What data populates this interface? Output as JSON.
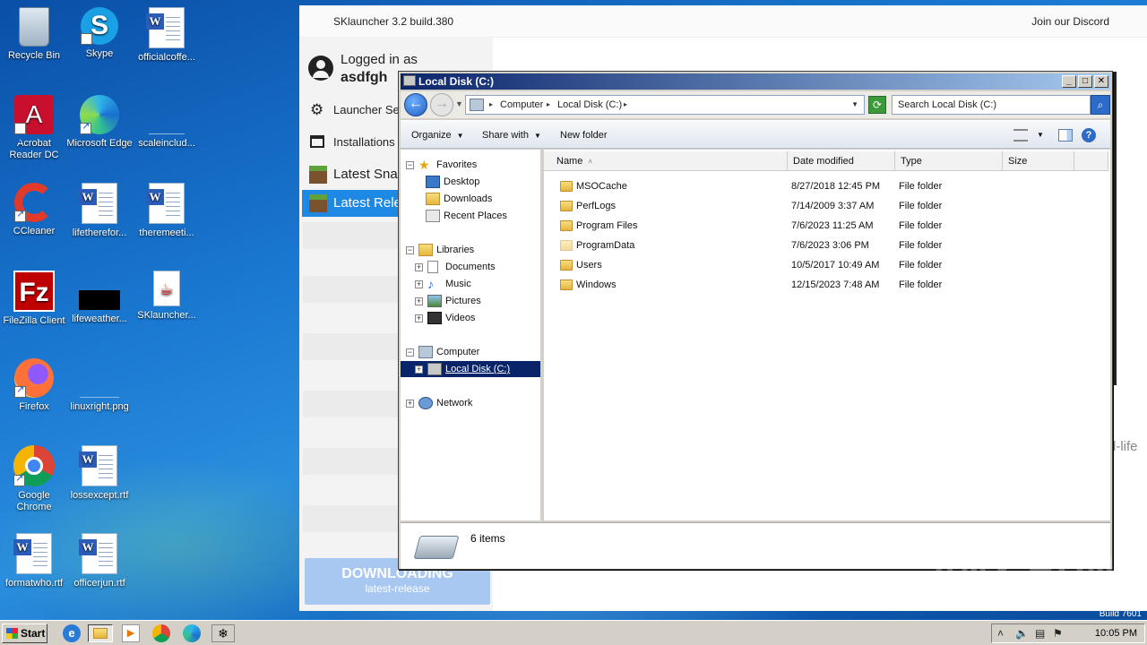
{
  "desktop_icons": [
    {
      "label": "Recycle Bin",
      "icon": "recycle-bin-icon"
    },
    {
      "label": "Skype",
      "icon": "skype-icon"
    },
    {
      "label": "officialcoffe...",
      "icon": "word-doc-icon"
    },
    {
      "label": "Acrobat Reader DC",
      "icon": "acrobat-icon"
    },
    {
      "label": "Microsoft Edge",
      "icon": "edge-icon"
    },
    {
      "label": "scaleinclud...",
      "icon": "image-file-icon"
    },
    {
      "label": "CCleaner",
      "icon": "ccleaner-icon"
    },
    {
      "label": "lifetherefor...",
      "icon": "word-doc-icon"
    },
    {
      "label": "theremeeti...",
      "icon": "word-doc-icon"
    },
    {
      "label": "FileZilla Client",
      "icon": "filezilla-icon"
    },
    {
      "label": "lifeweather...",
      "icon": "image-file-icon"
    },
    {
      "label": "SKlauncher...",
      "icon": "java-file-icon"
    },
    {
      "label": "Firefox",
      "icon": "firefox-icon"
    },
    {
      "label": "linuxright.png",
      "icon": "image-file-icon"
    },
    {
      "label": "Google Chrome",
      "icon": "chrome-icon"
    },
    {
      "label": "lossexcept.rtf",
      "icon": "word-doc-icon"
    },
    {
      "label": "formatwho.rtf",
      "icon": "word-doc-icon"
    },
    {
      "label": "officerjun.rtf",
      "icon": "word-doc-icon"
    }
  ],
  "sklauncher": {
    "title": "SKlauncher 3.2 build.380",
    "discord": "Join our Discord",
    "logged_in_as": "Logged in as",
    "username": "asdfgh",
    "menu": [
      {
        "label": "Launcher Se",
        "icon": "gear-icon"
      },
      {
        "label": "Installations",
        "icon": "installations-icon"
      }
    ],
    "versions": [
      {
        "label": "Latest Sna",
        "selected": false
      },
      {
        "label": "Latest Rele",
        "selected": true
      }
    ],
    "download": {
      "label": "DOWNLOADING",
      "sub": "latest-release"
    },
    "fragment": "l-life"
  },
  "explorer": {
    "title": "Local Disk (C:)",
    "breadcrumb": [
      "Computer",
      "Local Disk (C:)"
    ],
    "search_placeholder": "Search Local Disk (C:)",
    "commands": {
      "organize": "Organize",
      "share": "Share with",
      "new_folder": "New folder"
    },
    "tree": {
      "favorites": "Favorites",
      "favorites_items": [
        "Desktop",
        "Downloads",
        "Recent Places"
      ],
      "libraries": "Libraries",
      "libraries_items": [
        "Documents",
        "Music",
        "Pictures",
        "Videos"
      ],
      "computer": "Computer",
      "local_disk": "Local Disk (C:)",
      "network": "Network"
    },
    "columns": [
      "Name",
      "Date modified",
      "Type",
      "Size"
    ],
    "rows": [
      {
        "name": "MSOCache",
        "date": "8/27/2018 12:45 PM",
        "type": "File folder"
      },
      {
        "name": "PerfLogs",
        "date": "7/14/2009 3:37 AM",
        "type": "File folder"
      },
      {
        "name": "Program Files",
        "date": "7/6/2023 11:25 AM",
        "type": "File folder"
      },
      {
        "name": "ProgramData",
        "date": "7/6/2023 3:06 PM",
        "type": "File folder"
      },
      {
        "name": "Users",
        "date": "10/5/2017 10:49 AM",
        "type": "File folder"
      },
      {
        "name": "Windows",
        "date": "12/15/2023 7:48 AM",
        "type": "File folder"
      }
    ],
    "status": "6 items"
  },
  "taskbar": {
    "start": "Start",
    "clock": "10:05 PM",
    "build": "Build 7601"
  },
  "watermark": "ANY RUN"
}
